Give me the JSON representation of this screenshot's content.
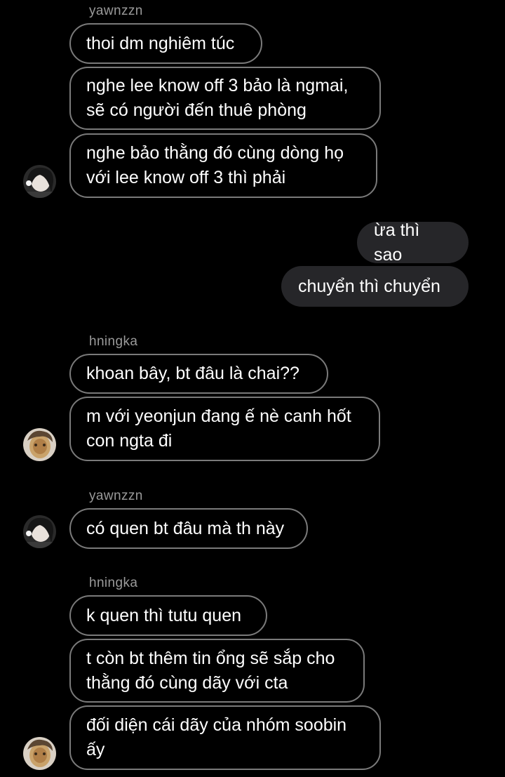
{
  "messages": [
    {
      "sender": "yawnzzn"
    },
    {
      "text": "thoi dm nghiêm túc"
    },
    {
      "text": "nghe lee know off 3 bảo là ngmai,\nsẽ có người đến thuê phòng"
    },
    {
      "text": "nghe bảo thằng đó cùng dòng họ\nvới lee know off 3 thì phải"
    },
    {
      "text": "ừa thì sao"
    },
    {
      "text": "chuyển thì chuyển"
    },
    {
      "sender": "hningka"
    },
    {
      "text": "khoan bây, bt đâu là chai??"
    },
    {
      "text": "m với yeonjun đang ế nè canh hốt\ncon ngta đi"
    },
    {
      "sender": "yawnzzn"
    },
    {
      "text": "có quen bt đâu mà th này"
    },
    {
      "sender": "hningka"
    },
    {
      "text": "k quen thì tutu quen"
    },
    {
      "text": "t còn bt thêm tin ổng sẽ sắp cho\nthằng đó cùng dãy với cta"
    },
    {
      "text": "đối diện cái dãy của nhóm soobin\nấy"
    }
  ],
  "colors": {
    "background": "#000000",
    "incoming_border": "#7a7a7a",
    "outgoing_fill": "#262629",
    "sender_name": "#9a9a9a"
  },
  "icons": {
    "yawnzzn_avatar": "profile-photo-dark-hair",
    "hningka_avatar": "profile-photo-warm-toned"
  }
}
